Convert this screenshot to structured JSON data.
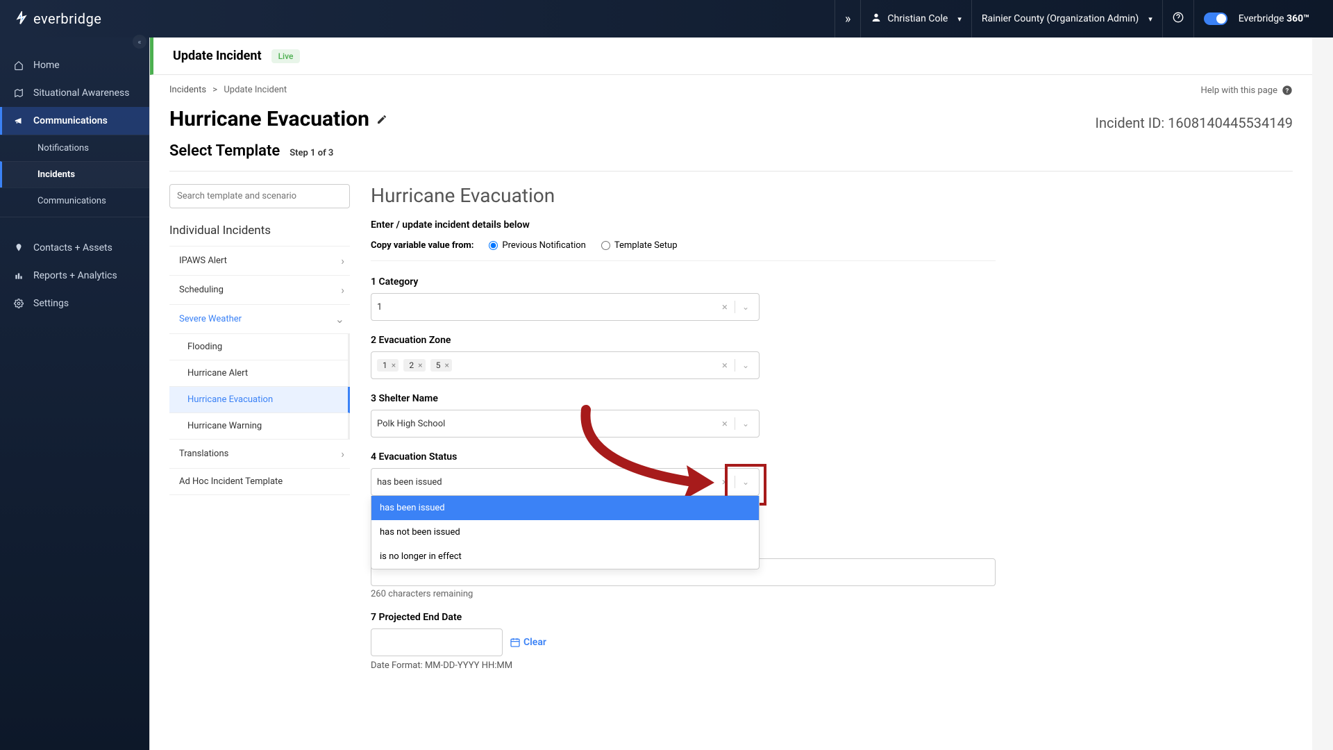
{
  "topbar": {
    "brand": "everbridge",
    "user_name": "Christian Cole",
    "org_name": "Rainier County (Organization Admin)",
    "product_brand": "Everbridge",
    "product_suffix": "360™"
  },
  "sidebar": {
    "items": [
      {
        "label": "Home"
      },
      {
        "label": "Situational Awareness"
      },
      {
        "label": "Communications"
      },
      {
        "label": "Contacts + Assets"
      },
      {
        "label": "Reports + Analytics"
      },
      {
        "label": "Settings"
      }
    ],
    "sub_comm": [
      {
        "label": "Notifications"
      },
      {
        "label": "Incidents"
      },
      {
        "label": "Communications"
      }
    ]
  },
  "header": {
    "title": "Update Incident",
    "status_badge": "Live"
  },
  "breadcrumb": {
    "root": "Incidents",
    "sep": ">",
    "current": "Update Incident",
    "help_text": "Help with this page"
  },
  "incident": {
    "title": "Hurricane Evacuation",
    "id_label": "Incident ID:",
    "id_value": "1608140445534149",
    "subtitle": "Select Template",
    "step": "Step 1 of 3"
  },
  "templates": {
    "search_placeholder": "Search template and scenario",
    "section_title": "Individual Incidents",
    "groups": [
      {
        "label": "IPAWS Alert",
        "expanded": false
      },
      {
        "label": "Scheduling",
        "expanded": false
      },
      {
        "label": "Severe Weather",
        "expanded": true,
        "children": [
          {
            "label": "Flooding"
          },
          {
            "label": "Hurricane Alert"
          },
          {
            "label": "Hurricane Evacuation",
            "selected": true
          },
          {
            "label": "Hurricane Warning"
          }
        ]
      },
      {
        "label": "Translations",
        "expanded": false
      },
      {
        "label": "Ad Hoc Incident Template",
        "leaf": true
      }
    ]
  },
  "form": {
    "panel_title": "Hurricane Evacuation",
    "hint": "Enter / update incident details below",
    "copy_label": "Copy variable value from:",
    "copy_opt_prev": "Previous Notification",
    "copy_opt_tmpl": "Template Setup",
    "fields": {
      "category": {
        "label": "1 Category",
        "value": "1"
      },
      "zone": {
        "label": "2 Evacuation Zone",
        "chips": [
          "1",
          "2",
          "5"
        ]
      },
      "shelter": {
        "label": "3 Shelter Name",
        "value": "Polk High School"
      },
      "status": {
        "label": "4 Evacuation Status",
        "value": "has been issued",
        "options": [
          "has been issued",
          "has not been issued",
          "is no longer in effect"
        ]
      },
      "chars_remaining": "260 characters remaining",
      "end_date": {
        "label": "7 Projected End Date",
        "clear": "Clear",
        "format_hint": "Date Format: MM-DD-YYYY HH:MM"
      }
    }
  }
}
